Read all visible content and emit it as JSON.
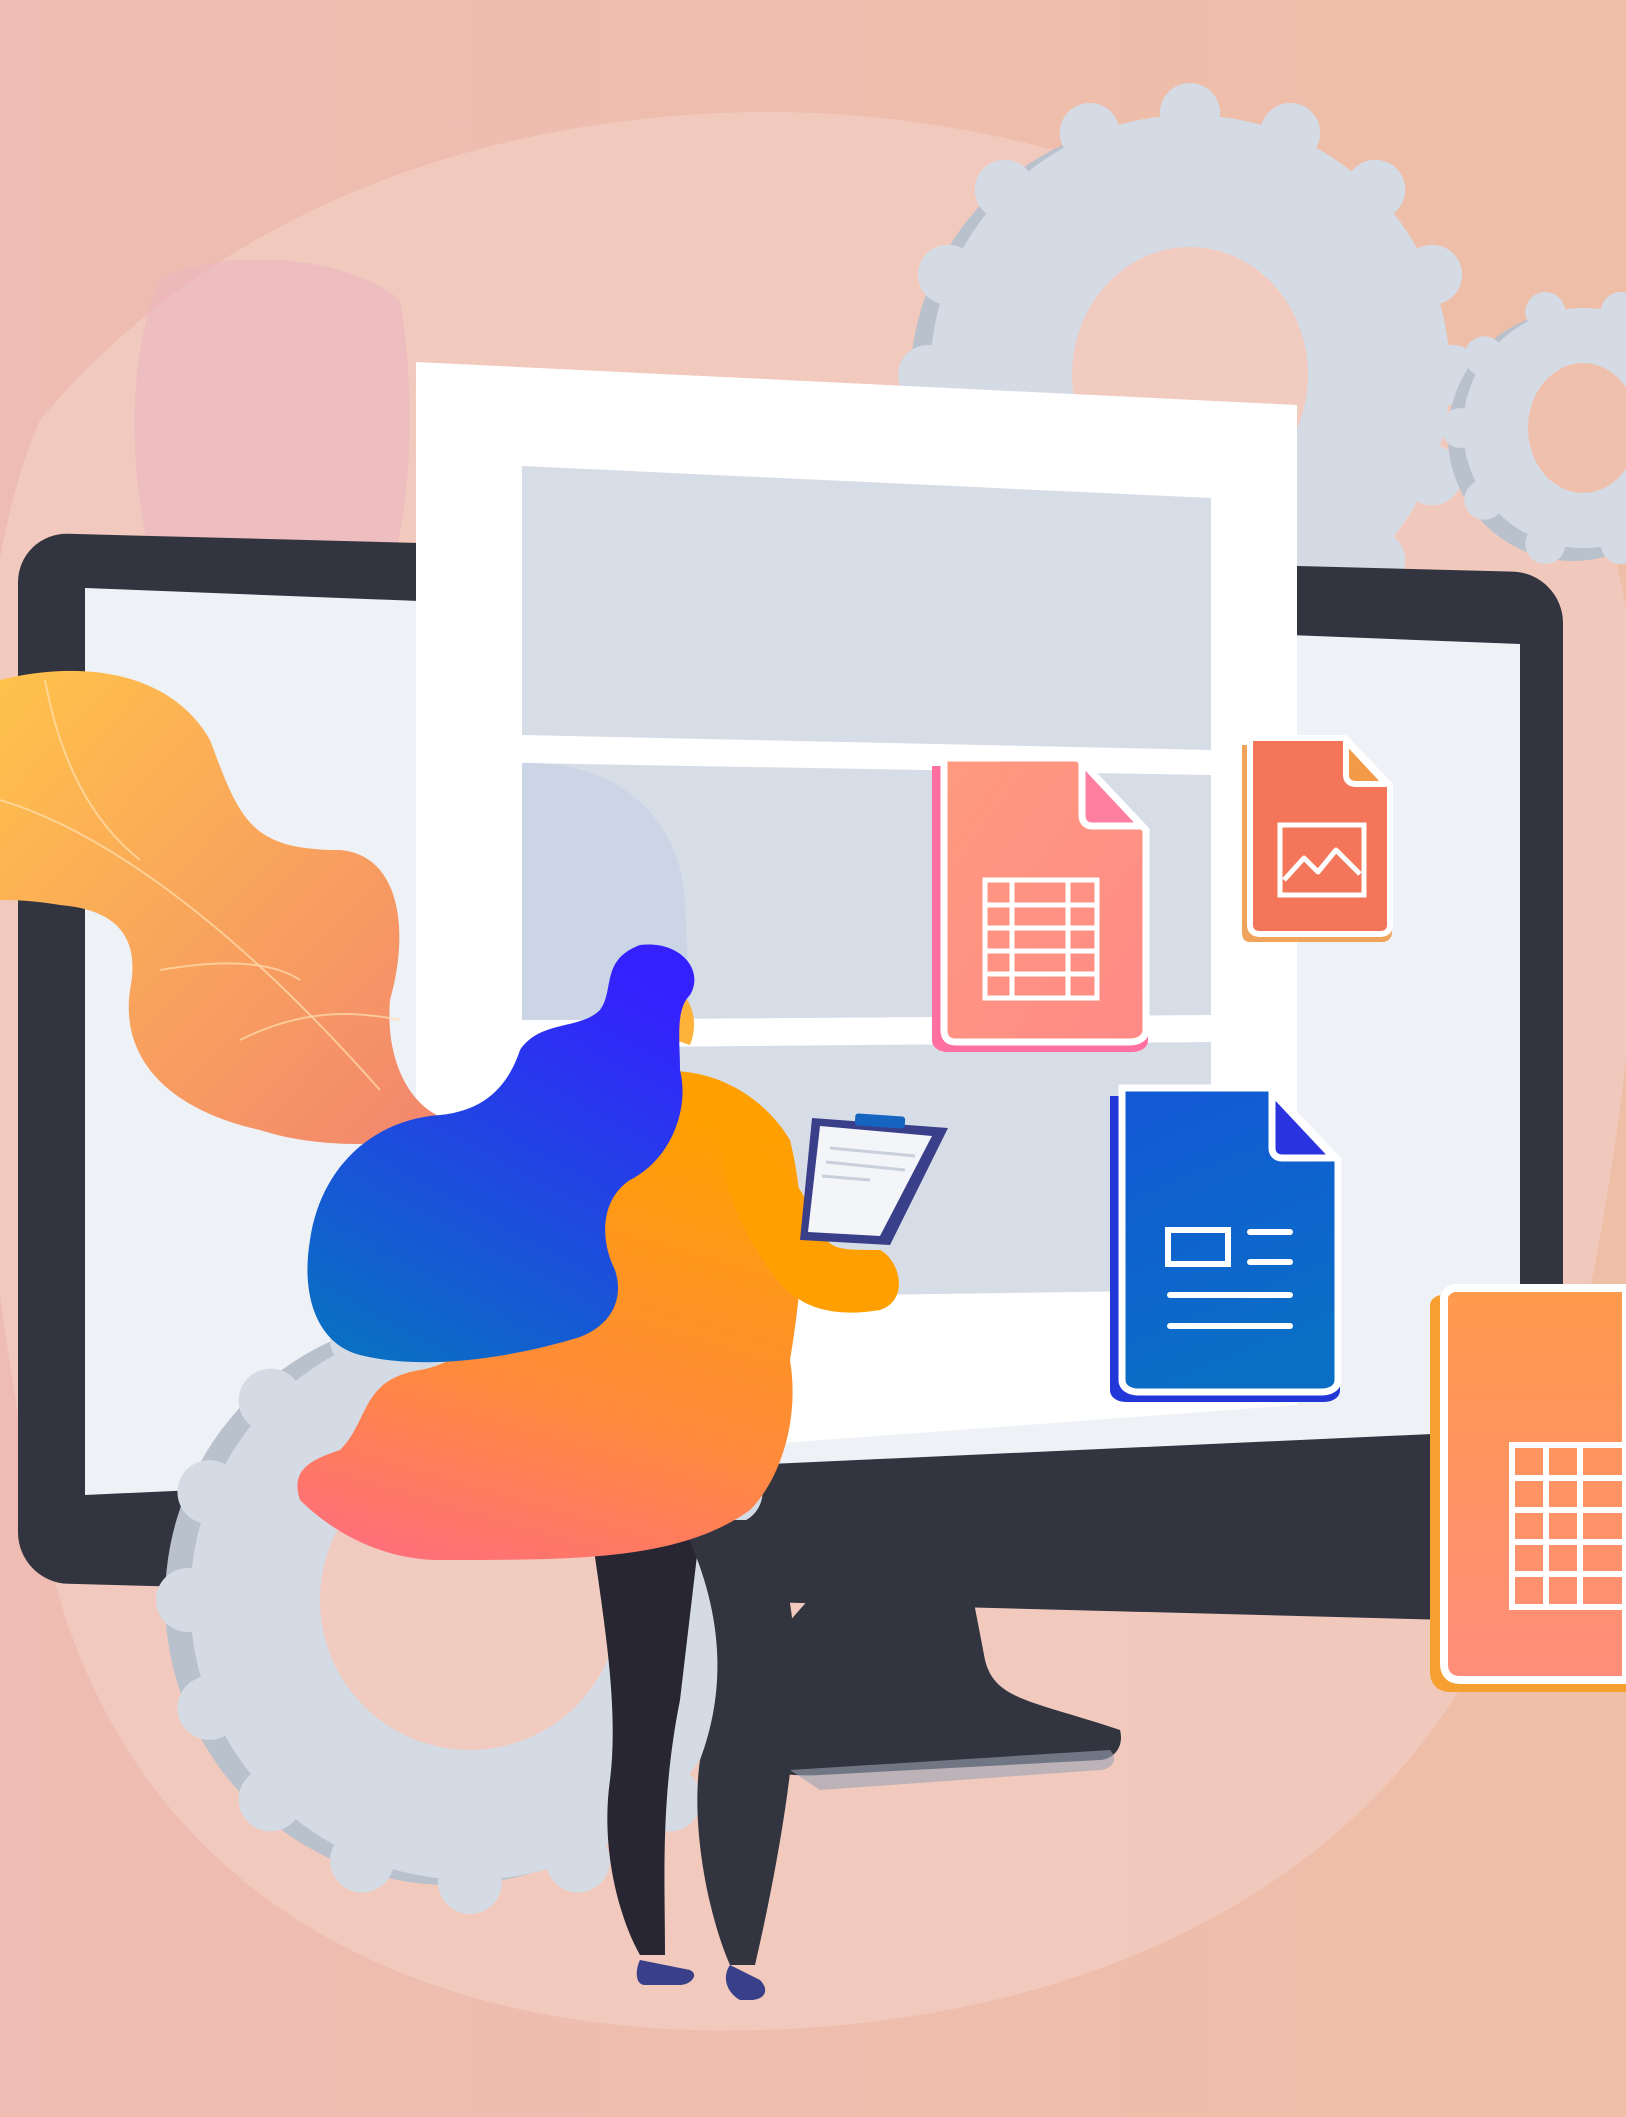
{
  "illustration": {
    "subject": "woman-with-clipboard-at-monitor",
    "icons": [
      "spreadsheet-file-icon",
      "image-file-icon",
      "document-file-icon",
      "gear-icon"
    ]
  },
  "colors": {
    "background": "#efbfae",
    "blob": "#f1cbbf",
    "monitor_frame": "#32343f",
    "screen": "#eef2f7",
    "panel": "#ffffff",
    "placeholder": "#d7dde7",
    "gear": "#d5dbe5",
    "gear_shadow": "#b9c1cd",
    "leaf_orange_start": "#ffc24a",
    "leaf_orange_end": "#f3896e",
    "hair_top": "#3520ff",
    "hair_bottom": "#0a6fc3",
    "shirt": "#ffa000",
    "shirt_bottom": "#ff6f78",
    "spreadsheet_file": "#ff8f82",
    "image_file": "#f3765a",
    "document_file": "#0a66c8",
    "big_spreadsheet_file": "#ff9760"
  }
}
